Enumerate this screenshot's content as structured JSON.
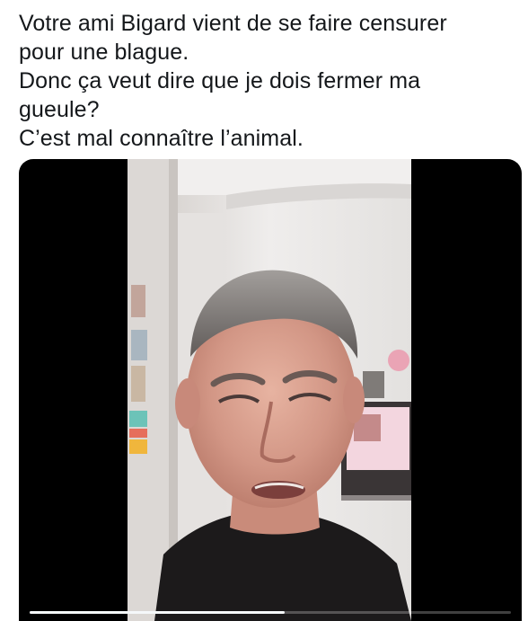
{
  "tweet": {
    "lines": [
      "Votre ami Bigard vient de se faire censurer",
      "pour une blague.",
      "Donc ça veut dire que je dois fermer ma",
      "gueule?",
      "C’est mal connaître l’animal."
    ]
  },
  "video": {
    "progress": 0.53
  }
}
